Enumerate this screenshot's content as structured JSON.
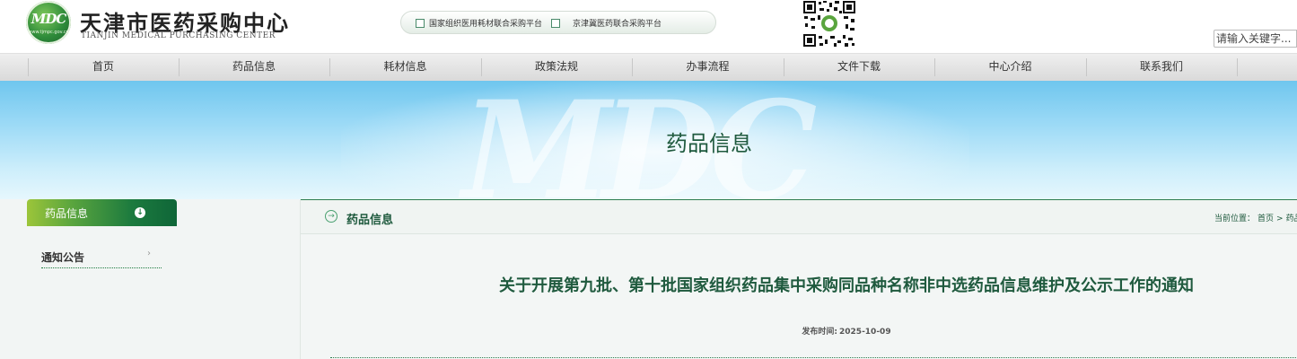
{
  "header": {
    "logo_text": "MDC",
    "logo_url_small": "www.tjmpc.gov.cn",
    "title_cn": "天津市医药采购中心",
    "title_en": "TIANJIN MEDICAL PURCHASING CENTER",
    "platforms": [
      {
        "label": "国家组织医用耗材联合采购平台"
      },
      {
        "label": "京津冀医药联合采购平台"
      }
    ],
    "search_placeholder": "请输入关键字..."
  },
  "nav": {
    "items": [
      {
        "label": "首页"
      },
      {
        "label": "药品信息"
      },
      {
        "label": "耗材信息"
      },
      {
        "label": "政策法规"
      },
      {
        "label": "办事流程"
      },
      {
        "label": "文件下载"
      },
      {
        "label": "中心介绍"
      },
      {
        "label": "联系我们"
      }
    ]
  },
  "banner": {
    "title": "药品信息",
    "watermark": "MDC"
  },
  "sidebar": {
    "heading": "药品信息",
    "items": [
      {
        "label": "通知公告"
      }
    ]
  },
  "main": {
    "section_title": "药品信息",
    "breadcrumb": {
      "prefix": "当前位置：",
      "home": "首页",
      "sep": ">",
      "current": "药品信息"
    },
    "article": {
      "title": "关于开展第九批、第十批国家组织药品集中采购同品种名称非中选药品信息维护及公示工作的通知",
      "date_label": "发布时间:",
      "date_value": "2025-10-09"
    }
  },
  "colors": {
    "brand_green": "#1f5a3e",
    "accent_green": "#1c7a3e",
    "banner_blue": "#6fc6ee"
  }
}
